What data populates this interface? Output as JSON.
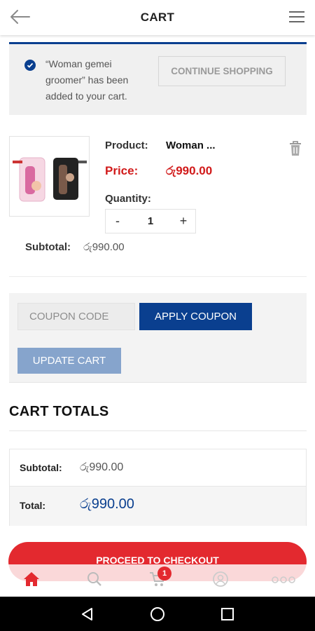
{
  "header": {
    "title": "CART"
  },
  "notice": {
    "message": "“Woman gemei groomer” has been added to your cart.",
    "continue_label": "CONTINUE SHOPPING"
  },
  "product": {
    "product_label": "Product:",
    "product_name": "Woman ...",
    "price_label": "Price:",
    "price_value": "රු990.00",
    "quantity_label": "Quantity:",
    "quantity_minus": "-",
    "quantity_value": "1",
    "quantity_plus": "+",
    "subtotal_label": "Subtotal:",
    "subtotal_value": "රු990.00"
  },
  "coupon": {
    "placeholder": "COUPON CODE",
    "apply_label": "APPLY COUPON",
    "update_label": "UPDATE CART"
  },
  "totals": {
    "title": "CART TOTALS",
    "subtotal_label": "Subtotal:",
    "subtotal_value": "රු990.00",
    "total_label": "Total:",
    "total_value": "රු990.00",
    "checkout_label": "PROCEED TO CHECKOUT"
  },
  "bottom_nav": {
    "items": [
      "home-icon",
      "search-icon",
      "cart-icon",
      "account-icon",
      "more-icon"
    ],
    "cart_badge": "1",
    "active_color": "#e3292f"
  },
  "colors": {
    "brand_blue": "#0a3f8f",
    "accent_red": "#e3292f",
    "price_red": "#d11a1a"
  }
}
